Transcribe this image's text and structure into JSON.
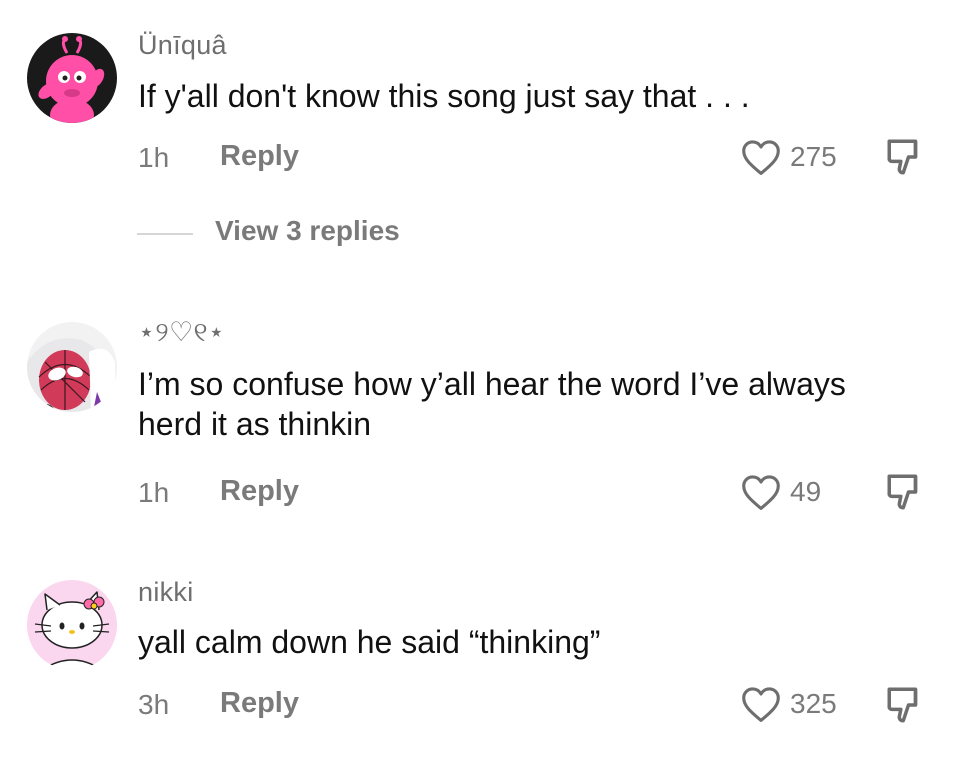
{
  "comments": [
    {
      "username": "Ünīquâ",
      "text": "If y'all don't know this song just say that . . .",
      "time": "1h",
      "reply_label": "Reply",
      "likes": "275",
      "view_replies": "View 3 replies",
      "avatar": "pink-character-avatar"
    },
    {
      "username": "⋆୨♡୧⋆",
      "text": "I’m so confuse how y’all hear the word I’ve always herd it as thinkin",
      "time": "1h",
      "reply_label": "Reply",
      "likes": "49",
      "avatar": "spider-hero-avatar"
    },
    {
      "username": "nikki",
      "text": "yall calm down he said “thinking”",
      "time": "3h",
      "reply_label": "Reply",
      "likes": "325",
      "avatar": "kitty-avatar"
    }
  ],
  "icons": {
    "like": "heart-outline-icon",
    "dislike": "thumbs-down-icon"
  },
  "colors": {
    "muted_text": "#7a7a7a",
    "username": "#6e6e6e",
    "pink_avatar_bg": "#ff5bb0"
  }
}
